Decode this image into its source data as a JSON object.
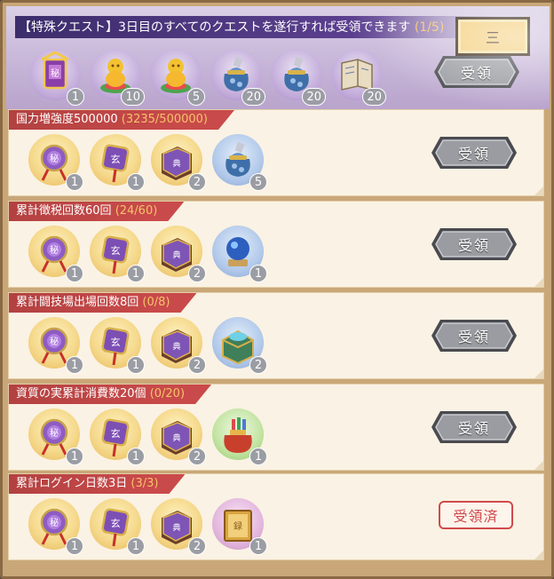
{
  "header": {
    "title_main": "【特殊クエスト】3日目のすべてのクエストを遂行すれば受領できます",
    "title_progress": "(1/5)",
    "close_label": "三",
    "claim_label": "受領",
    "items": [
      {
        "icon": "purple-chest-icon",
        "count": "1",
        "bg": "bg-hdr"
      },
      {
        "icon": "gold-figure-icon",
        "count": "10",
        "bg": "bg-hdr"
      },
      {
        "icon": "gold-figure-icon",
        "count": "5",
        "bg": "bg-hdr"
      },
      {
        "icon": "treasure-bag-icon",
        "count": "20",
        "bg": "bg-hdr"
      },
      {
        "icon": "treasure-bag-icon",
        "count": "20",
        "bg": "bg-hdr"
      },
      {
        "icon": "scroll-book-icon",
        "count": "20",
        "bg": "bg-hdr"
      }
    ]
  },
  "quests": [
    {
      "title": "国力増強度500000",
      "progress": "(3235/500000)",
      "status": "claim",
      "claim_label": "受領",
      "items": [
        {
          "icon": "purple-coin-icon",
          "count": "1",
          "bg": "bg-gold"
        },
        {
          "icon": "purple-talisman-icon",
          "count": "1",
          "bg": "bg-gold"
        },
        {
          "icon": "skill-book-icon",
          "count": "2",
          "bg": "bg-gold"
        },
        {
          "icon": "treasure-bag-icon",
          "count": "5",
          "bg": "bg-blue"
        }
      ]
    },
    {
      "title": "累計徴税回数60回",
      "progress": "(24/60)",
      "status": "claim",
      "claim_label": "受領",
      "items": [
        {
          "icon": "purple-coin-icon",
          "count": "1",
          "bg": "bg-gold"
        },
        {
          "icon": "purple-talisman-icon",
          "count": "1",
          "bg": "bg-gold"
        },
        {
          "icon": "skill-book-icon",
          "count": "2",
          "bg": "bg-gold"
        },
        {
          "icon": "crystal-orb-icon",
          "count": "1",
          "bg": "bg-blue"
        }
      ]
    },
    {
      "title": "累計闘技場出場回数8回",
      "progress": "(0/8)",
      "status": "claim",
      "claim_label": "受領",
      "items": [
        {
          "icon": "purple-coin-icon",
          "count": "1",
          "bg": "bg-gold"
        },
        {
          "icon": "purple-talisman-icon",
          "count": "1",
          "bg": "bg-gold"
        },
        {
          "icon": "skill-book-icon",
          "count": "2",
          "bg": "bg-gold"
        },
        {
          "icon": "jade-chest-icon",
          "count": "2",
          "bg": "bg-blue"
        }
      ]
    },
    {
      "title": "資質の実累計消費数20個",
      "progress": "(0/20)",
      "status": "claim",
      "claim_label": "受領",
      "items": [
        {
          "icon": "purple-coin-icon",
          "count": "1",
          "bg": "bg-gold"
        },
        {
          "icon": "purple-talisman-icon",
          "count": "1",
          "bg": "bg-gold"
        },
        {
          "icon": "skill-book-icon",
          "count": "2",
          "bg": "bg-gold"
        },
        {
          "icon": "lucky-bag-icon",
          "count": "1",
          "bg": "bg-green"
        }
      ]
    },
    {
      "title": "累計ログイン日数3日",
      "progress": "(3/3)",
      "status": "claimed",
      "claim_label": "受領済",
      "items": [
        {
          "icon": "purple-coin-icon",
          "count": "1",
          "bg": "bg-gold"
        },
        {
          "icon": "purple-talisman-icon",
          "count": "1",
          "bg": "bg-gold"
        },
        {
          "icon": "skill-book-icon",
          "count": "2",
          "bg": "bg-gold"
        },
        {
          "icon": "golden-book-icon",
          "count": "1",
          "bg": "bg-purple"
        }
      ]
    }
  ],
  "colors": {
    "title_bar": "#c94a4a",
    "progress_text": "#f5c36b",
    "claimed_red": "#d04a4a",
    "button_gray": "#8e9095"
  }
}
